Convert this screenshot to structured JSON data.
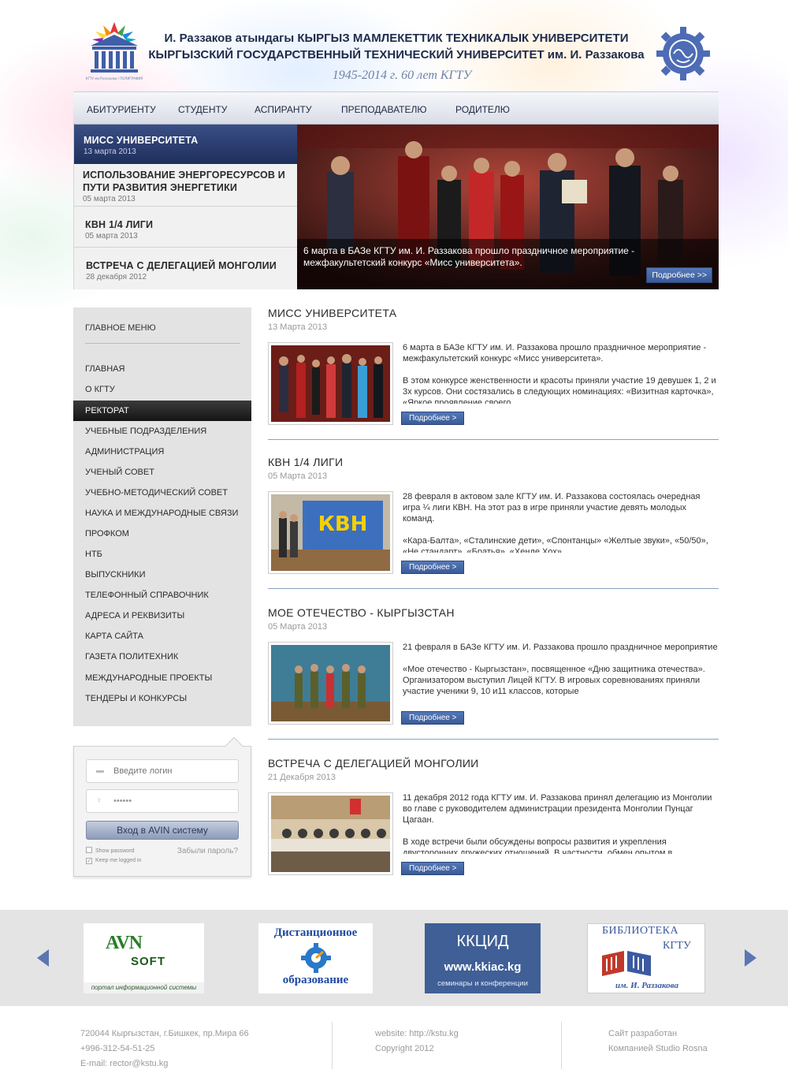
{
  "header": {
    "title_kg": "И. Раззаков атындагы КЫРГЫЗ МАМЛЕКЕТТИК ТЕХНИКАЛЫК УНИВЕРСИТЕТИ",
    "title_ru": "КЫРГЫЗСКИЙ ГОСУДАРСТВЕННЫЙ ТЕХНИЧЕСКИЙ УНИВЕРСИТЕТ им. И. Раззакова",
    "anniversary": "1945-2014 г.  60 лет КГТУ",
    "logo_caption": "КГТУ им.Раззакова / ПОЛИГРАФИЯ"
  },
  "topnav": [
    "АБИТУРИЕНТУ",
    "СТУДЕНТУ",
    "АСПИРАНТУ",
    "ПРЕПОДАВАТЕЛЮ",
    "РОДИТЕЛЮ"
  ],
  "slider": {
    "items": [
      {
        "title": "МИСС УНИВЕРСИТЕТА",
        "date": "13 марта 2013"
      },
      {
        "title": "ИСПОЛЬЗОВАНИЕ ЭНЕРГОРЕСУРСОВ И ПУТИ РАЗВИТИЯ ЭНЕРГЕТИКИ",
        "date": "05 марта 2013"
      },
      {
        "title": "КВН 1/4 ЛИГИ",
        "date": "05 марта 2013"
      },
      {
        "title": "ВСТРЕЧА С ДЕЛЕГАЦИЕЙ МОНГОЛИИ",
        "date": "28 декабря 2012"
      }
    ],
    "caption": "6 марта в БАЗе КГТУ им. И. Раззакова  прошло праздничное мероприятие - межфакультетский конкурс «Мисс университета».",
    "more": "Подробнее >>"
  },
  "sidebar": {
    "heading": "ГЛАВНОЕ МЕНЮ",
    "items": [
      "ГЛАВНАЯ",
      "О КГТУ",
      "РЕКТОРАТ",
      "УЧЕБНЫЕ ПОДРАЗДЕЛЕНИЯ",
      "АДМИНИСТРАЦИЯ",
      "УЧЕНЫЙ СОВЕТ",
      "УЧЕБНО-МЕТОДИЧЕСКИЙ СОВЕТ",
      "НАУКА И МЕЖДУНАРОДНЫЕ СВЯЗИ",
      "ПРОФКОМ",
      "НТБ",
      "ВЫПУСКНИКИ",
      "ТЕЛЕФОННЫЙ СПРАВОЧНИК",
      "АДРЕСА И РЕКВИЗИТЫ",
      "КАРТА САЙТА",
      "ГАЗЕТА ПОЛИТЕХНИК",
      "МЕЖДУНАРОДНЫЕ ПРОЕКТЫ",
      "ТЕНДЕРЫ И КОНКУРСЫ"
    ],
    "active_index": 2
  },
  "login": {
    "login_placeholder": "Введите логин",
    "password_value": "••••••",
    "button": "Вход в AVIN систему",
    "show_password": "Show password",
    "keep_logged": "Keep me logged in",
    "forgot": "Забыли пароль?"
  },
  "news": [
    {
      "title": "МИСС УНИВЕРСИТЕТА",
      "date": "13 Марта 2013",
      "p1": "6 марта в БАЗе КГТУ им. И. Раззакова  прошло праздничное мероприятие - межфакультетский конкурс «Мисс университета».",
      "p2": "В этом  конкурсе женственности и красоты приняли участие 19 девушек 1, 2 и 3х курсов. Они состязались в следующих номинациях: «Визитная карточка», «Яркое проявление своего",
      "more": "Подробнее >"
    },
    {
      "title": "КВН 1/4 ЛИГИ",
      "date": "05 Марта 2013",
      "p1": "28 февраля в актовом зале КГТУ им. И. Раззакова состоялась очередная игра ¼ лиги КВН. На этот раз в игре приняли участие девять молодых команд.",
      "p2": "«Кара-Балта», «Сталинские дети», «Спонтанцы» «Желтые звуки», «50/50», «Не стандарт», «Братья», «Хенде Хох».",
      "more": "Подробнее >"
    },
    {
      "title": "МОЕ ОТЕЧЕСТВО - КЫРГЫЗСТАН",
      "date": "05 Марта 2013",
      "p1": "21 февраля в БАЗе КГТУ им. И. Раззакова прошло праздничное мероприятие",
      "p2": "«Мое отечество - Кыргызстан», посвященное «Дню защитника отечества». Организатором выступил Лицей КГТУ. В игровых соревнованиях приняли участие ученики 9, 10 и11 классов, которые",
      "more": "Подробнее >"
    },
    {
      "title": "ВСТРЕЧА С ДЕЛЕГАЦИЕЙ МОНГОЛИИ",
      "date": "21 Декабря 2013",
      "p1": "11 декабря 2012 года КГТУ им. И. Раззакова  принял делегацию из Монголии во главе с руководителем администрации президента Монголии Пунцаг Цагаан.",
      "p2": "В ходе встречи были обсуждены вопросы развития и укрепления двусторонних дружеских отношений. В частности, обмен опытом в",
      "more": "Подробнее >"
    }
  ],
  "partners": {
    "avn": {
      "l1": "AVN",
      "l2": "SOFT",
      "l3": "портал информационной системы"
    },
    "dist": {
      "l1": "Дистанционное",
      "l2": "образование"
    },
    "kkiac": {
      "l1": "ККЦИД",
      "l2": "www.kkiac.kg",
      "l3": "семинары и конференции"
    },
    "lib": {
      "l1": "БИБЛИОТЕКА",
      "l2": "КГТУ",
      "l3": "им. И. Раззакова"
    }
  },
  "footer": {
    "address": "720044 Кыргызстан, г.Бишкек, пр.Мира 66",
    "phone": "+996-312-54-51-25",
    "email": "E-mail: rector@kstu.kg",
    "website": "website: http://kstu.kg",
    "copyright": "Copyright 2012",
    "dev1": "Сайт разработан",
    "dev2": "Компанией Studio Rosna"
  },
  "colors": {
    "accent": "#3a5b98",
    "nav_dark": "#1f2f5c",
    "rule": "#8aa0c2"
  }
}
